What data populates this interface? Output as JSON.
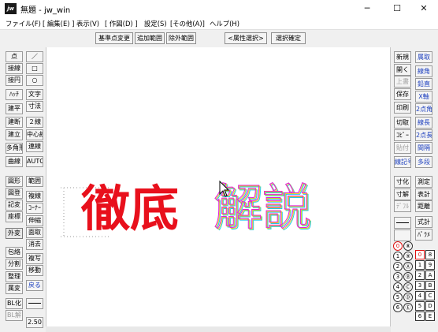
{
  "window": {
    "app_icon": "jw",
    "title": "無題 - jw_win",
    "minimize": "─",
    "maximize": "☐",
    "close": "✕"
  },
  "menu": [
    "ファイル(F)",
    "[ 編集(E) ]",
    "表示(V)",
    "[ 作図(D) ]",
    "設定(S)",
    "[その他(A)]",
    "ヘルプ(H)"
  ],
  "toolbar": [
    "基準点変更",
    "追加範囲",
    "除外範囲",
    "<属性選択>",
    "選択確定"
  ],
  "left_palette": {
    "col1": [
      "点",
      "接線",
      "接円",
      "ﾊｯﾁ",
      "建平",
      "建断",
      "建立",
      "多角形",
      "曲線",
      "図形",
      "図登",
      "記変",
      "座標",
      "外変",
      "包絡",
      "分割",
      "整理",
      "属変",
      "BL化",
      "BL解"
    ],
    "col2": [
      "／",
      "□",
      "○",
      "文字",
      "寸法",
      "２線",
      "中心線",
      "連線",
      "AUTO",
      "範囲",
      "複線",
      "ｺｰﾅｰ",
      "伸縮",
      "面取",
      "消去",
      "複写",
      "移動",
      "戻る",
      "",
      "2.50"
    ]
  },
  "right_palette": {
    "col1": [
      "新規",
      "開く",
      "上書",
      "保存",
      "印刷",
      "切取",
      "ｺﾋﾟｰ",
      "貼付",
      "線記号",
      "寸化",
      "寸解",
      "ﾃﾞﾌﾙ",
      "",
      ""
    ],
    "col2": [
      "属取",
      "線角",
      "鉛直",
      "X軸",
      "2点角",
      "線長",
      "2点長",
      "間隔",
      "多段",
      "測定",
      "表計",
      "距離",
      "式計",
      "ﾊﾟﾗﾒ"
    ]
  },
  "layer_buttons": {
    "circles_left": [
      "0",
      "1",
      "2",
      "3",
      "4",
      "5",
      "6"
    ],
    "circles_mid": [
      "⑧",
      "⑨",
      "Ⓐ",
      "Ⓑ",
      "Ⓒ",
      "Ⓓ",
      "Ⓔ"
    ],
    "squares_a": [
      "0",
      "1",
      "2",
      "3",
      "4",
      "5",
      "6"
    ],
    "squares_b": [
      "8",
      "9",
      "A",
      "B",
      "C",
      "D",
      "E"
    ]
  },
  "canvas_text": {
    "red_word": "徹底",
    "outline_word": "解説"
  },
  "colors": {
    "red": "#e8101c",
    "outline_a": "#e020e0",
    "outline_b": "#20c8e8",
    "outline_c": "#e8d020"
  }
}
